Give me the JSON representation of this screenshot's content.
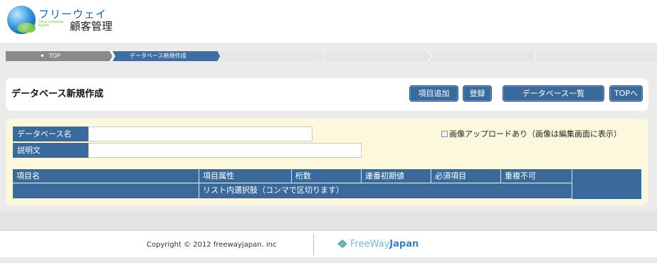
{
  "header": {
    "logo_jp": "フリーウェイ",
    "logo_sub": "Cloud Computing System",
    "logo_title": "顧客管理"
  },
  "breadcrumb": {
    "home": "TOP",
    "current": "データベース新規作成"
  },
  "page": {
    "title": "データベース新規作成",
    "buttons": {
      "add_item": "項目追加",
      "register": "登録",
      "db_list": "データベース一覧",
      "top": "TOPへ"
    }
  },
  "form": {
    "db_name_label": "データベース名",
    "db_name_value": "",
    "description_label": "説明文",
    "description_value": "",
    "image_upload_label": "画像アップロードあり（画像は編集画面に表示）",
    "table_headers": [
      "項目名",
      "項目属性",
      "桁数",
      "連番初期値",
      "必須項目",
      "重複不可"
    ],
    "list_options_header": "リスト内選択肢（コンマで区切ります）"
  },
  "footer": {
    "copyright": "Copyright © 2012 freewayjapan. inc",
    "brand_light": "FreeWay",
    "brand_bold": "Japan"
  },
  "colors": {
    "accent": "#3a6a9c",
    "form_bg": "#fbf8dd"
  }
}
